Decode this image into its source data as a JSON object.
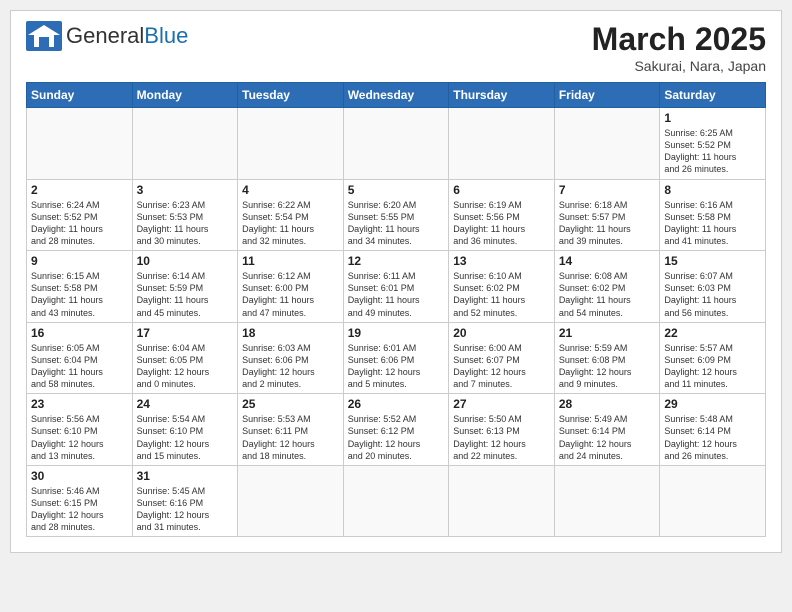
{
  "header": {
    "logo_general": "General",
    "logo_blue": "Blue",
    "title": "March 2025",
    "subtitle": "Sakurai, Nara, Japan"
  },
  "days_of_week": [
    "Sunday",
    "Monday",
    "Tuesday",
    "Wednesday",
    "Thursday",
    "Friday",
    "Saturday"
  ],
  "weeks": [
    [
      {
        "day": "",
        "info": ""
      },
      {
        "day": "",
        "info": ""
      },
      {
        "day": "",
        "info": ""
      },
      {
        "day": "",
        "info": ""
      },
      {
        "day": "",
        "info": ""
      },
      {
        "day": "",
        "info": ""
      },
      {
        "day": "1",
        "info": "Sunrise: 6:25 AM\nSunset: 5:52 PM\nDaylight: 11 hours\nand 26 minutes."
      }
    ],
    [
      {
        "day": "2",
        "info": "Sunrise: 6:24 AM\nSunset: 5:52 PM\nDaylight: 11 hours\nand 28 minutes."
      },
      {
        "day": "3",
        "info": "Sunrise: 6:23 AM\nSunset: 5:53 PM\nDaylight: 11 hours\nand 30 minutes."
      },
      {
        "day": "4",
        "info": "Sunrise: 6:22 AM\nSunset: 5:54 PM\nDaylight: 11 hours\nand 32 minutes."
      },
      {
        "day": "5",
        "info": "Sunrise: 6:20 AM\nSunset: 5:55 PM\nDaylight: 11 hours\nand 34 minutes."
      },
      {
        "day": "6",
        "info": "Sunrise: 6:19 AM\nSunset: 5:56 PM\nDaylight: 11 hours\nand 36 minutes."
      },
      {
        "day": "7",
        "info": "Sunrise: 6:18 AM\nSunset: 5:57 PM\nDaylight: 11 hours\nand 39 minutes."
      },
      {
        "day": "8",
        "info": "Sunrise: 6:16 AM\nSunset: 5:58 PM\nDaylight: 11 hours\nand 41 minutes."
      }
    ],
    [
      {
        "day": "9",
        "info": "Sunrise: 6:15 AM\nSunset: 5:58 PM\nDaylight: 11 hours\nand 43 minutes."
      },
      {
        "day": "10",
        "info": "Sunrise: 6:14 AM\nSunset: 5:59 PM\nDaylight: 11 hours\nand 45 minutes."
      },
      {
        "day": "11",
        "info": "Sunrise: 6:12 AM\nSunset: 6:00 PM\nDaylight: 11 hours\nand 47 minutes."
      },
      {
        "day": "12",
        "info": "Sunrise: 6:11 AM\nSunset: 6:01 PM\nDaylight: 11 hours\nand 49 minutes."
      },
      {
        "day": "13",
        "info": "Sunrise: 6:10 AM\nSunset: 6:02 PM\nDaylight: 11 hours\nand 52 minutes."
      },
      {
        "day": "14",
        "info": "Sunrise: 6:08 AM\nSunset: 6:02 PM\nDaylight: 11 hours\nand 54 minutes."
      },
      {
        "day": "15",
        "info": "Sunrise: 6:07 AM\nSunset: 6:03 PM\nDaylight: 11 hours\nand 56 minutes."
      }
    ],
    [
      {
        "day": "16",
        "info": "Sunrise: 6:05 AM\nSunset: 6:04 PM\nDaylight: 11 hours\nand 58 minutes."
      },
      {
        "day": "17",
        "info": "Sunrise: 6:04 AM\nSunset: 6:05 PM\nDaylight: 12 hours\nand 0 minutes."
      },
      {
        "day": "18",
        "info": "Sunrise: 6:03 AM\nSunset: 6:06 PM\nDaylight: 12 hours\nand 2 minutes."
      },
      {
        "day": "19",
        "info": "Sunrise: 6:01 AM\nSunset: 6:06 PM\nDaylight: 12 hours\nand 5 minutes."
      },
      {
        "day": "20",
        "info": "Sunrise: 6:00 AM\nSunset: 6:07 PM\nDaylight: 12 hours\nand 7 minutes."
      },
      {
        "day": "21",
        "info": "Sunrise: 5:59 AM\nSunset: 6:08 PM\nDaylight: 12 hours\nand 9 minutes."
      },
      {
        "day": "22",
        "info": "Sunrise: 5:57 AM\nSunset: 6:09 PM\nDaylight: 12 hours\nand 11 minutes."
      }
    ],
    [
      {
        "day": "23",
        "info": "Sunrise: 5:56 AM\nSunset: 6:10 PM\nDaylight: 12 hours\nand 13 minutes."
      },
      {
        "day": "24",
        "info": "Sunrise: 5:54 AM\nSunset: 6:10 PM\nDaylight: 12 hours\nand 15 minutes."
      },
      {
        "day": "25",
        "info": "Sunrise: 5:53 AM\nSunset: 6:11 PM\nDaylight: 12 hours\nand 18 minutes."
      },
      {
        "day": "26",
        "info": "Sunrise: 5:52 AM\nSunset: 6:12 PM\nDaylight: 12 hours\nand 20 minutes."
      },
      {
        "day": "27",
        "info": "Sunrise: 5:50 AM\nSunset: 6:13 PM\nDaylight: 12 hours\nand 22 minutes."
      },
      {
        "day": "28",
        "info": "Sunrise: 5:49 AM\nSunset: 6:14 PM\nDaylight: 12 hours\nand 24 minutes."
      },
      {
        "day": "29",
        "info": "Sunrise: 5:48 AM\nSunset: 6:14 PM\nDaylight: 12 hours\nand 26 minutes."
      }
    ],
    [
      {
        "day": "30",
        "info": "Sunrise: 5:46 AM\nSunset: 6:15 PM\nDaylight: 12 hours\nand 28 minutes."
      },
      {
        "day": "31",
        "info": "Sunrise: 5:45 AM\nSunset: 6:16 PM\nDaylight: 12 hours\nand 31 minutes."
      },
      {
        "day": "",
        "info": ""
      },
      {
        "day": "",
        "info": ""
      },
      {
        "day": "",
        "info": ""
      },
      {
        "day": "",
        "info": ""
      },
      {
        "day": "",
        "info": ""
      }
    ]
  ]
}
